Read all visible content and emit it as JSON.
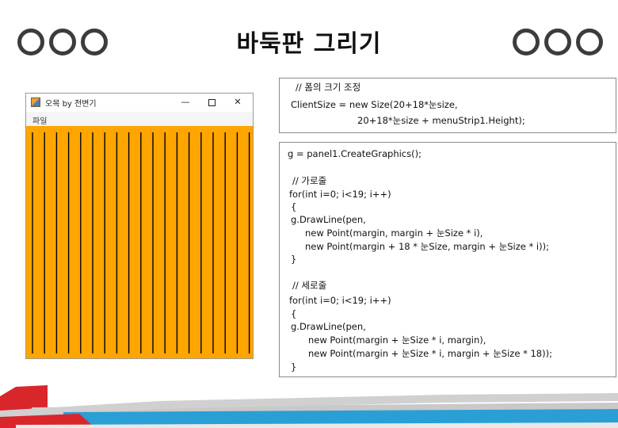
{
  "slide": {
    "title": "바둑판 그리기"
  },
  "window": {
    "title": "오목 by 전변기",
    "minimize": "—",
    "close": "✕",
    "menu_item": "파일",
    "icon": "app-icon",
    "panel_color": "#ffa500"
  },
  "board": {
    "visible_vertical_lines": 19
  },
  "code_top": [
    "// 폼의 크기 조정",
    "ClientSize = new Size(20+18*눈size,",
    "20+18*눈size + menuStrip1.Height);"
  ],
  "code_bottom": [
    "g = panel1.CreateGraphics();",
    "// 가로줄",
    "for(int i=0; i<19; i++)",
    "{",
    "g.DrawLine(pen,",
    "new Point(margin, margin + 눈Size * i),",
    "new Point(margin + 18 * 눈Size, margin + 눈Size * i));",
    "}",
    "// 세로줄",
    "for(int i=0; i<19; i++)",
    "{",
    "g.DrawLine(pen,",
    "new Point(margin + 눈Size * i, margin),",
    "new Point(margin + 눈Size * i, margin + 눈Size * 18));",
    "}"
  ],
  "colors": {
    "panel": "#ffa500",
    "footer_red": "#d9262b",
    "footer_blue": "#2a9fd6",
    "footer_gray": "#c9c9c9"
  }
}
